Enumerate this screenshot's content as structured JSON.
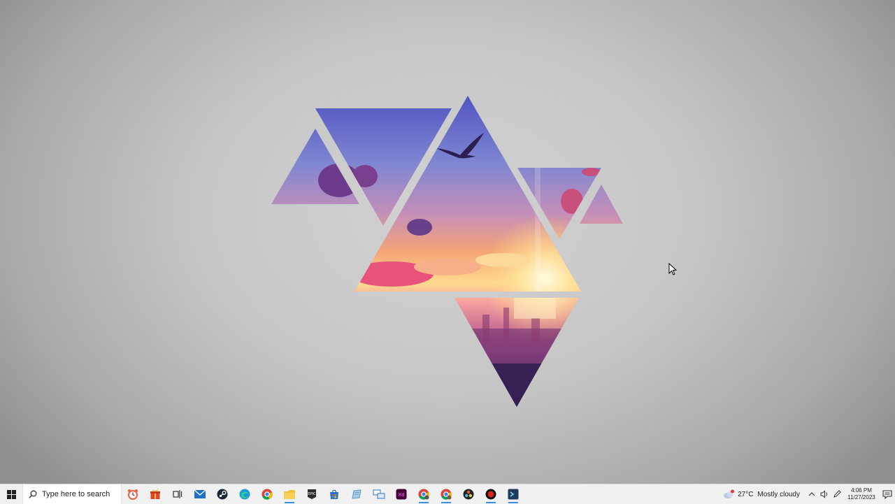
{
  "wallpaper": {
    "colors": {
      "sky_top": "#5a5fc0",
      "sky_mid": "#8a86cc",
      "horizon": "#f6b26b",
      "sun": "#fff3b0",
      "pink": "#e95b8a",
      "dusk": "#3a2a6a"
    }
  },
  "taskbar": {
    "search_placeholder": "Type here to search",
    "apps": [
      {
        "name": "alarms",
        "icon": "alarm-clock-icon",
        "color": "#e8613a"
      },
      {
        "name": "gift",
        "icon": "gift-icon",
        "color": "#e0452b"
      },
      {
        "name": "task-view",
        "icon": "task-view-icon",
        "color": "#333333"
      },
      {
        "name": "mail",
        "icon": "mail-icon",
        "color": "#1f6fc5"
      },
      {
        "name": "steam",
        "icon": "steam-icon",
        "color": "#1b2838"
      },
      {
        "name": "edge",
        "icon": "edge-icon",
        "color": "#1b9ae0"
      },
      {
        "name": "chrome",
        "icon": "chrome-icon",
        "color": "#db4437"
      },
      {
        "name": "file-explorer",
        "icon": "folder-icon",
        "color": "#f3c13a"
      },
      {
        "name": "epic-games",
        "icon": "epic-games-icon",
        "color": "#2a2a2a"
      },
      {
        "name": "store",
        "icon": "store-icon",
        "color": "#2a6cd6"
      },
      {
        "name": "notes",
        "icon": "notes-icon",
        "color": "#7db3d8"
      },
      {
        "name": "network-app",
        "icon": "network-icon",
        "color": "#4b8bd6"
      },
      {
        "name": "adobe-xd",
        "icon": "adobe-xd-icon",
        "color": "#470137"
      },
      {
        "name": "chrome-profile-1",
        "icon": "chrome-icon",
        "color": "#db4437"
      },
      {
        "name": "chrome-profile-2",
        "icon": "chrome-icon",
        "color": "#db4437"
      },
      {
        "name": "davinci",
        "icon": "davinci-icon",
        "color": "#222222"
      },
      {
        "name": "recorder",
        "icon": "record-icon",
        "color": "#e02020"
      },
      {
        "name": "terminal-app",
        "icon": "terminal-icon",
        "color": "#1f3c5a"
      }
    ],
    "weather": {
      "temp": "27°C",
      "condition": "Mostly cloudy"
    },
    "clock": {
      "time": "4:06 PM",
      "date": "11/27/2023"
    },
    "accent": "#3a8ee6"
  }
}
